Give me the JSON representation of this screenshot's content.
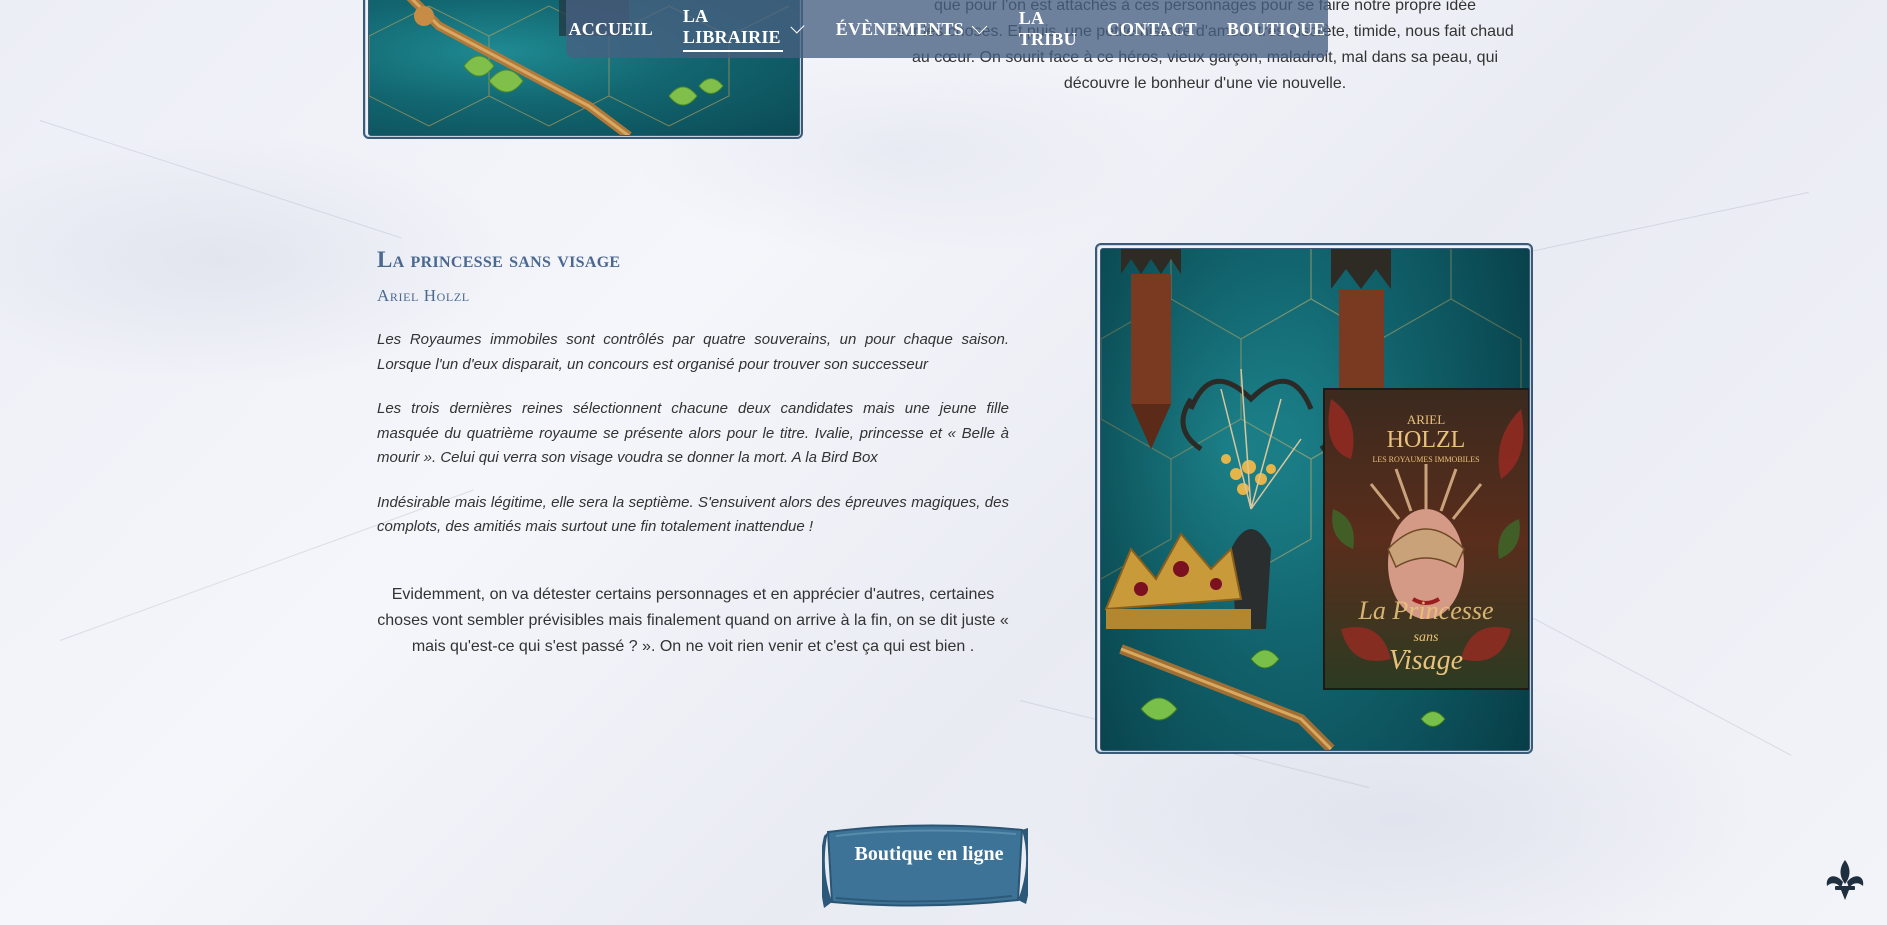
{
  "nav": {
    "items": [
      {
        "label": "ACCUEIL"
      },
      {
        "label": "LA LIBRAIRIE"
      },
      {
        "label": "ÉVÈNEMENTS"
      },
      {
        "label": "LA TRIBU"
      },
      {
        "label": "CONTACT"
      },
      {
        "label": "BOUTIQUE"
      }
    ],
    "active": "LA LIBRAIRIE"
  },
  "previous_review": {
    "line1": "que pour l'on est attachés à ces personnages pour se faire notre propre idée",
    "line2": "sur les choses. Et puis, une petite histoire d'amour très discrète, timide, nous fait chaud",
    "line3": "au cœur. On sourit face à ce héros, vieux garçon, maladroit, mal dans sa peau, qui",
    "line4": "découvre le bonheur d'une vie nouvelle."
  },
  "book": {
    "title": "La princesse sans visage",
    "author": "Ariel Holzl",
    "synopsis": [
      "Les Royaumes immobiles sont contrôlés par quatre souverains, un pour chaque saison. Lorsque l'un d'eux disparait, un concours est organisé pour trouver son successeur",
      "Les trois dernières reines sélectionnent chacune deux candidates mais une jeune fille masquée du quatrième royaume se présente alors pour le titre. Ivalie, princesse et « Belle à mourir ». Celui qui verra son visage voudra se donner la mort. A la Bird Box",
      "Indésirable mais légitime, elle sera la septième. S'ensuivent alors des épreuves magiques, des complots, des amitiés mais surtout une fin totalement inattendue !"
    ],
    "review": "Evidemment, on va détester certains personnages et en apprécier d'autres, certaines choses vont sembler prévisibles mais finalement quand on arrive à la fin, on se dit juste « mais qu'est-ce qui s'est passé ? ». On ne voit rien venir et c'est ça qui est bien .",
    "cover": {
      "author_text": "ARIEL HOLZL",
      "series_text": "LES ROYAUMES IMMOBILES",
      "title_text": "La Princesse sans Visage"
    }
  },
  "shop_button": {
    "label": "Boutique en ligne"
  },
  "icons": {
    "dropdown": "chevron-down-icon",
    "back_to_top": "fleur-de-lis-icon"
  },
  "colors": {
    "accent": "#4a6890",
    "nav_bg": "#486082",
    "frame": "#3a5a78",
    "scroll": "#3a6f93"
  }
}
